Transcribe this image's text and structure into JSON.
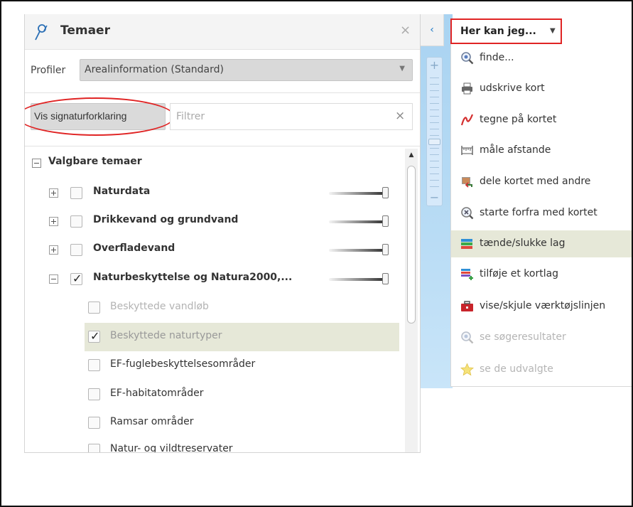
{
  "panel": {
    "title": "Temaer",
    "close_glyph": "×",
    "icon": "layers-pin-icon"
  },
  "profile": {
    "label": "Profiler",
    "selected": "Arealinformation (Standard)"
  },
  "legend_button": {
    "label": "Vis signaturforklaring",
    "highlight_color": "#e02424"
  },
  "filter": {
    "placeholder": "Filtrer",
    "value": "",
    "clear_glyph": "×"
  },
  "tree": {
    "root_label": "Valgbare temaer",
    "groups": [
      {
        "label": "Naturdata",
        "expanded": false,
        "checked": false,
        "opacity": 1.0
      },
      {
        "label": "Drikkevand og grundvand",
        "expanded": false,
        "checked": false,
        "opacity": 1.0
      },
      {
        "label": "Overfladevand",
        "expanded": false,
        "checked": false,
        "opacity": 1.0
      },
      {
        "label": "Naturbeskyttelse og Natura2000,...",
        "expanded": true,
        "checked": true,
        "opacity": 1.0
      }
    ],
    "children": [
      {
        "label": "Beskyttede vandløb",
        "checked": false,
        "disabled": true,
        "selected": false
      },
      {
        "label": "Beskyttede naturtyper",
        "checked": true,
        "disabled": true,
        "selected": true
      },
      {
        "label": "EF-fuglebeskyttelsesområder",
        "checked": false,
        "disabled": false,
        "selected": false
      },
      {
        "label": "EF-habitatområder",
        "checked": false,
        "disabled": false,
        "selected": false
      },
      {
        "label": "Ramsar områder",
        "checked": false,
        "disabled": false,
        "selected": false
      },
      {
        "label": "Natur- og vildtreservater",
        "checked": false,
        "disabled": false,
        "selected": false
      }
    ]
  },
  "map": {
    "collapse_glyph": "‹",
    "zoom_in": "+",
    "zoom_out": "−"
  },
  "menu": {
    "button_label": "Her kan jeg...",
    "button_arrow": "▼",
    "items": [
      {
        "label": "finde...",
        "icon": "magnifier-icon",
        "highlighted": false,
        "disabled": false
      },
      {
        "label": "udskrive kort",
        "icon": "printer-icon",
        "highlighted": false,
        "disabled": false
      },
      {
        "label": "tegne på kortet",
        "icon": "draw-line-icon",
        "highlighted": false,
        "disabled": false
      },
      {
        "label": "måle afstande",
        "icon": "ruler-icon",
        "highlighted": false,
        "disabled": false
      },
      {
        "label": "dele kortet med andre",
        "icon": "share-map-icon",
        "highlighted": false,
        "disabled": false
      },
      {
        "label": "starte forfra med kortet",
        "icon": "reset-map-icon",
        "highlighted": false,
        "disabled": false
      },
      {
        "label": "tænde/slukke lag",
        "icon": "layers-icon",
        "highlighted": true,
        "disabled": false
      },
      {
        "label": "tilføje et kortlag",
        "icon": "add-layer-icon",
        "highlighted": false,
        "disabled": false
      },
      {
        "label": "vise/skjule værktøjslinjen",
        "icon": "toolbox-icon",
        "highlighted": false,
        "disabled": false
      },
      {
        "label": "se søgeresultater",
        "icon": "search-results-icon",
        "highlighted": false,
        "disabled": true
      },
      {
        "label": "se de udvalgte",
        "icon": "star-icon",
        "highlighted": false,
        "disabled": true
      }
    ]
  },
  "colors": {
    "accent": "#e02424",
    "highlight_row": "#e6e8d8",
    "disabled_text": "#b5b5b5",
    "map_blue": "#b9dcf5"
  }
}
